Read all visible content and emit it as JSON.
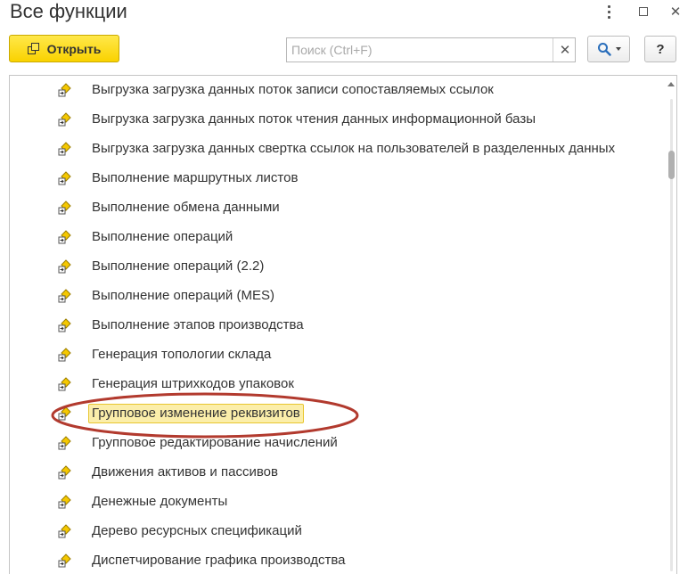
{
  "window": {
    "title": "Все функции",
    "more_icon": "more-vertical-icon",
    "maximize_icon": "maximize-icon",
    "close_label": "✕"
  },
  "toolbar": {
    "open_label": "Открыть",
    "open_icon": "open-window-icon",
    "search_placeholder": "Поиск (Ctrl+F)",
    "search_value": "",
    "search_clear_label": "✕",
    "search_icon": "magnifier-icon",
    "help_label": "?"
  },
  "list": {
    "item_icon": "function-item-icon",
    "items": [
      {
        "label": "Выгрузка загрузка данных поток записи сопоставляемых ссылок",
        "selected": false
      },
      {
        "label": "Выгрузка загрузка данных поток чтения данных информационной базы",
        "selected": false
      },
      {
        "label": "Выгрузка загрузка данных свертка ссылок на пользователей в разделенных данных",
        "selected": false
      },
      {
        "label": "Выполнение маршрутных листов",
        "selected": false
      },
      {
        "label": "Выполнение обмена данными",
        "selected": false
      },
      {
        "label": "Выполнение операций",
        "selected": false
      },
      {
        "label": "Выполнение операций (2.2)",
        "selected": false
      },
      {
        "label": "Выполнение операций (MES)",
        "selected": false
      },
      {
        "label": "Выполнение этапов производства",
        "selected": false
      },
      {
        "label": "Генерация топологии склада",
        "selected": false
      },
      {
        "label": "Генерация штрихкодов упаковок",
        "selected": false
      },
      {
        "label": "Групповое изменение реквизитов",
        "selected": true
      },
      {
        "label": "Групповое редактирование начислений",
        "selected": false
      },
      {
        "label": "Движения активов и пассивов",
        "selected": false
      },
      {
        "label": "Денежные документы",
        "selected": false
      },
      {
        "label": "Дерево ресурсных спецификаций",
        "selected": false
      },
      {
        "label": "Диспетчирование графика производства",
        "selected": false
      }
    ]
  },
  "colors": {
    "accent_yellow": "#fad200",
    "selection_fill": "#fbeeaa",
    "annotation_ellipse": "#b23a2e"
  }
}
